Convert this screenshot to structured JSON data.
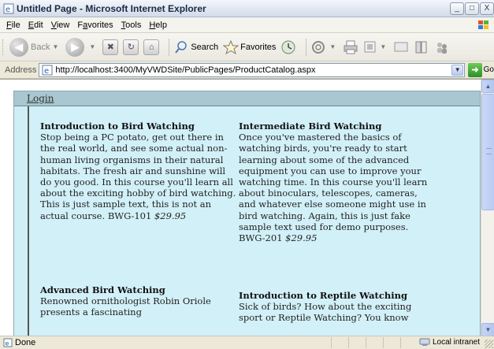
{
  "window": {
    "title": "Untitled Page - Microsoft Internet Explorer",
    "controls": {
      "minimize": "_",
      "maximize": "□",
      "close": "X"
    }
  },
  "menu": {
    "items": [
      {
        "first": "F",
        "rest": "ile"
      },
      {
        "first": "E",
        "rest": "dit"
      },
      {
        "first": "V",
        "rest": "iew"
      },
      {
        "first": "",
        "rest": "Favorites",
        "pre": "F",
        "u": "a",
        "post": "vorites"
      },
      {
        "first": "T",
        "rest": "ools"
      },
      {
        "first": "H",
        "rest": "elp"
      }
    ]
  },
  "toolbar": {
    "back_label": "Back",
    "search_label": "Search",
    "favorites_label": "Favorites"
  },
  "address": {
    "label": "Address",
    "url": "http://localhost:3400/MyVWDSite/PublicPages/ProductCatalog.aspx",
    "go_label": "Go"
  },
  "page": {
    "login_label": "Login",
    "courses": [
      {
        "title": "Introduction to Bird Watching",
        "description": "Stop being a PC potato, get out there in the real world, and see some actual non-human living organisms in their natural habitats. The fresh air and sunshine will do you good. In this course you'll learn all about the exciting hobby of bird watching. This is just sample text, this is not an actual course.",
        "code": "BWG-101",
        "price": "$29.95"
      },
      {
        "title": "Intermediate Bird Watching",
        "description": "Once you've mastered the basics of watching birds, you're ready to start learning about some of the advanced equipment you can use to improve your watching time. In this course you'll learn about binoculars, telescopes, cameras, and whatever else someone might use in bird watching. Again, this is just fake sample text used for demo purposes.",
        "code": "BWG-201",
        "price": "$29.95"
      },
      {
        "title": "Advanced Bird Watching",
        "description": "Renowned ornithologist Robin Oriole presents a fascinating",
        "code": "",
        "price": ""
      },
      {
        "title": "Introduction to Reptile Watching",
        "description": "Sick of birds? How about the exciting sport or Reptile Watching? You know",
        "code": "",
        "price": ""
      }
    ]
  },
  "status": {
    "text": "Done",
    "zone": "Local intranet"
  },
  "colors": {
    "page_panel": "#d2f0f8",
    "header_band": "#a8c7d1"
  }
}
